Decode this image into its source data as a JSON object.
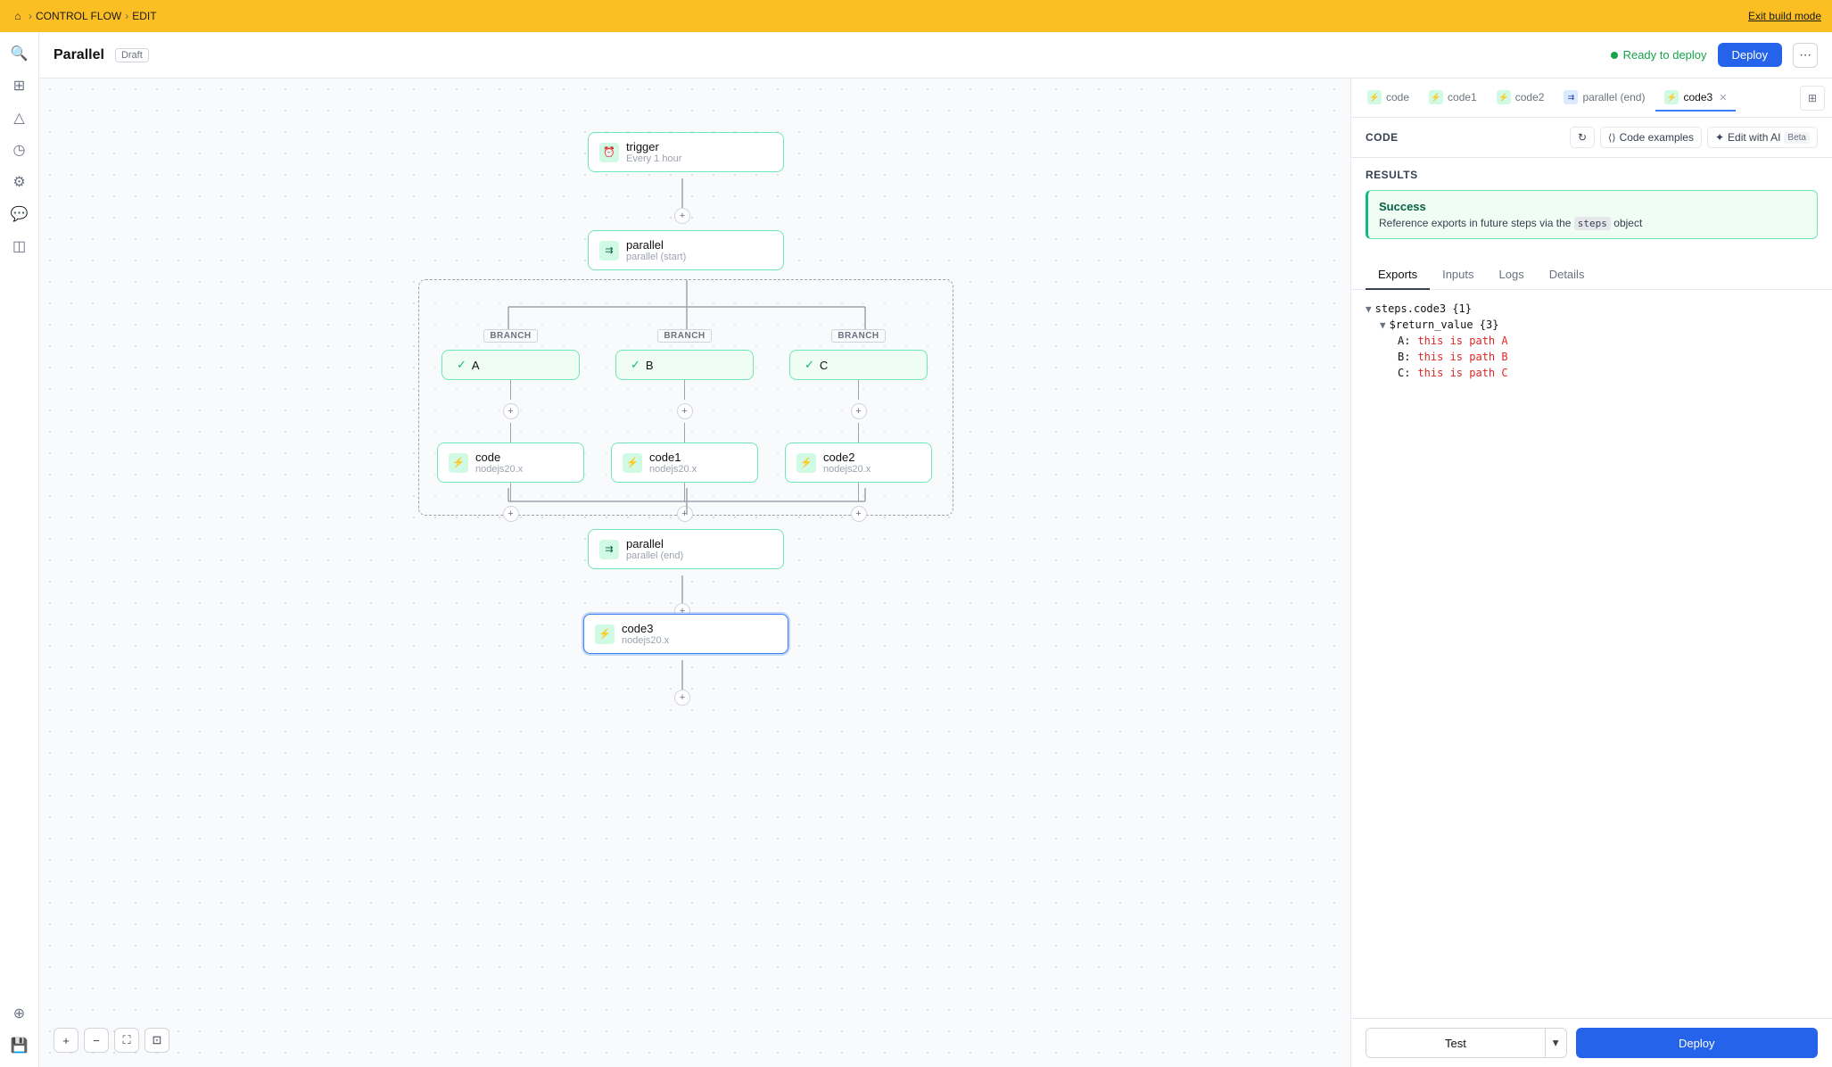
{
  "topbar": {
    "home_icon": "⌂",
    "breadcrumb": [
      "CONTROL FLOW",
      "EDIT"
    ],
    "exit_link": "Exit build mode"
  },
  "header": {
    "title": "Parallel",
    "draft": "Draft",
    "ready_text": "Ready to deploy",
    "deploy_label": "Deploy",
    "more_label": "⋯"
  },
  "sidebar": {
    "icons": [
      {
        "name": "search-icon",
        "symbol": "🔍"
      },
      {
        "name": "layout-icon",
        "symbol": "⊞"
      },
      {
        "name": "warning-icon",
        "symbol": "△"
      },
      {
        "name": "clock-icon",
        "symbol": "🕐"
      },
      {
        "name": "settings-icon",
        "symbol": "⚙"
      },
      {
        "name": "chat-icon",
        "symbol": "💬"
      },
      {
        "name": "tag-icon",
        "symbol": "🏷"
      },
      {
        "name": "add-square-icon",
        "symbol": "⊕"
      },
      {
        "name": "save-icon",
        "symbol": "💾"
      }
    ]
  },
  "canvas": {
    "trigger_name": "trigger",
    "trigger_sub": "Every 1 hour",
    "parallel_start_name": "parallel",
    "parallel_start_sub": "parallel (start)",
    "parallel_end_name": "parallel",
    "parallel_end_sub": "parallel (end)",
    "branches": [
      "BRANCH",
      "BRANCH",
      "BRANCH"
    ],
    "branch_labels": [
      "A",
      "B",
      "C"
    ],
    "branch_nodes": [
      {
        "name": "code",
        "sub": "nodejs20.x"
      },
      {
        "name": "code1",
        "sub": "nodejs20.x"
      },
      {
        "name": "code2",
        "sub": "nodejs20.x"
      }
    ],
    "code3_name": "code3",
    "code3_sub": "nodejs20.x",
    "plus_symbol": "+"
  },
  "right_panel": {
    "tabs": [
      {
        "label": "code",
        "icon_type": "green",
        "active": false
      },
      {
        "label": "code1",
        "icon_type": "green",
        "active": false
      },
      {
        "label": "code2",
        "icon_type": "green",
        "active": false
      },
      {
        "label": "parallel (end)",
        "icon_type": "blue",
        "active": false
      },
      {
        "label": "code3",
        "icon_type": "green",
        "active": true,
        "closeable": true
      }
    ],
    "section_code": "CODE",
    "section_results": "RESULTS",
    "btn_refresh": "↻",
    "btn_code_examples": "Code examples",
    "btn_edit_ai": "✦ Edit with AI",
    "beta": "Beta",
    "success": {
      "title": "Success",
      "desc_prefix": "Reference exports in future steps via the",
      "code": "steps",
      "desc_suffix": "object"
    },
    "subtabs": [
      "Exports",
      "Inputs",
      "Logs",
      "Details"
    ],
    "active_subtab": "Exports",
    "tree": {
      "root": "steps.code3 {1}",
      "child": "$return_value {3}",
      "items": [
        {
          "key": "A:",
          "value": "this is path A"
        },
        {
          "key": "B:",
          "value": "this is path B"
        },
        {
          "key": "C:",
          "value": "this is path C"
        }
      ]
    },
    "footer": {
      "test_label": "Test",
      "deploy_label": "Deploy"
    }
  },
  "canvas_toolbar": {
    "plus": "+",
    "minus": "−",
    "fit": "⛶",
    "lock": "⊡"
  }
}
